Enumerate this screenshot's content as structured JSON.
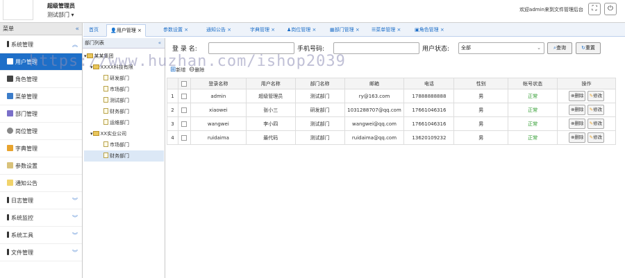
{
  "header": {
    "user_name": "超级管理员",
    "user_dept": "测试部门",
    "welcome": "欢迎admin来到文件管理后台",
    "fullscreen_icon": "fullscreen-icon",
    "power_icon": "power-icon"
  },
  "sidebar": {
    "title": "菜单",
    "items": [
      {
        "label": "系统管理"
      },
      {
        "label": "用户管理"
      },
      {
        "label": "角色管理"
      },
      {
        "label": "菜单管理"
      },
      {
        "label": "部门管理"
      },
      {
        "label": "岗位管理"
      },
      {
        "label": "字典管理"
      },
      {
        "label": "参数设置"
      },
      {
        "label": "通知公告"
      },
      {
        "label": "日志管理"
      },
      {
        "label": "系统监控"
      },
      {
        "label": "系统工具"
      },
      {
        "label": "文件管理"
      }
    ]
  },
  "tabs": [
    {
      "label": "首页"
    },
    {
      "label": "用户管理"
    },
    {
      "label": "参数设置"
    },
    {
      "label": "通知公告"
    },
    {
      "label": "字典管理"
    },
    {
      "label": "岗位管理"
    },
    {
      "label": "部门管理"
    },
    {
      "label": "菜单管理"
    },
    {
      "label": "角色管理"
    }
  ],
  "tab_close": "×",
  "dept_panel": {
    "title": "部门列表",
    "tree": [
      {
        "label": "某某集团"
      },
      {
        "label": "XXXX科技有限"
      },
      {
        "label": "研发部门"
      },
      {
        "label": "市场部门"
      },
      {
        "label": "测试部门"
      },
      {
        "label": "财务部门"
      },
      {
        "label": "运维部门"
      },
      {
        "label": "XX实业公司"
      },
      {
        "label": "市场部门"
      },
      {
        "label": "财务部门"
      }
    ]
  },
  "search": {
    "login_label": "登 录 名:",
    "phone_label": "手机号码:",
    "status_label": "用户状态:",
    "status_value": "全部",
    "query_btn": "查询",
    "reset_btn": "重置"
  },
  "toolbar": {
    "add": "新增",
    "delete": "删除"
  },
  "table": {
    "headers": [
      "登录名称",
      "用户名称",
      "部门名称",
      "邮箱",
      "电话",
      "性别",
      "帐号状态",
      "操作"
    ],
    "rows": [
      {
        "no": "1",
        "login": "admin",
        "name": "超级管理员",
        "dept": "测试部门",
        "email": "ry@163.com",
        "phone": "17888888888",
        "sex": "男",
        "status": "正常"
      },
      {
        "no": "2",
        "login": "xiaowei",
        "name": "张小三",
        "dept": "研发部门",
        "email": "1031288707@qq.com",
        "phone": "17661046316",
        "sex": "男",
        "status": "正常"
      },
      {
        "no": "3",
        "login": "wangwei",
        "name": "李小四",
        "dept": "测试部门",
        "email": "wangwei@qq.com",
        "phone": "17661046316",
        "sex": "男",
        "status": "正常"
      },
      {
        "no": "4",
        "login": "ruidaima",
        "name": "最代码",
        "dept": "测试部门",
        "email": "ruidaima@qq.com",
        "phone": "13620109232",
        "sex": "男",
        "status": "正常"
      }
    ],
    "action_delete": "删除",
    "action_edit": "修改"
  },
  "watermark": "https://www.huzhan.com/ishop2039",
  "colors": {
    "accent": "#1e6fc8",
    "status_ok": "#2a9a2a"
  }
}
